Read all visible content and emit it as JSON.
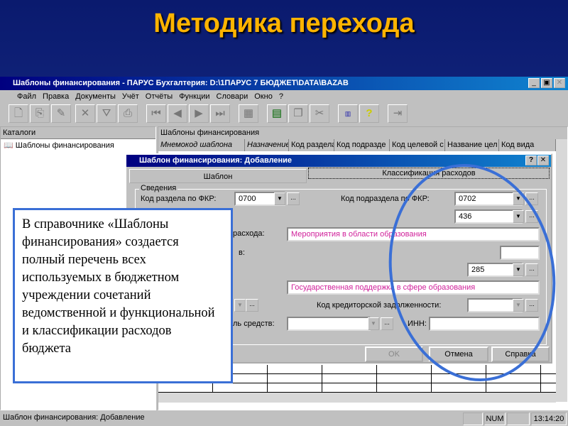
{
  "slide": {
    "title": "Методика перехода",
    "callout": "В справочнике «Шаблоны финансирования» создается полный перечень всех используемых в бюджетном учреждении сочетаний ведомственной и функциональной и классификации расходов бюджета",
    "accent": "#3a6fd6"
  },
  "window": {
    "title": "Шаблоны финансирования - ПАРУС Бухгалтерия: D:\\1ПАРУС 7 БЮДЖЕТ\\DATA\\BAZAB",
    "menu": [
      "Файл",
      "Правка",
      "Документы",
      "Учёт",
      "Отчёты",
      "Функции",
      "Словари",
      "Окно",
      "?"
    ],
    "left_pane": {
      "header": "Каталоги",
      "item": "Шаблоны финансирования"
    },
    "right_pane": {
      "header": "Шаблоны финансирования",
      "columns": [
        "Мнемокод шаблона",
        "Назначение",
        "Код раздела п",
        "Код подразде",
        "Код целевой с",
        "Название цел",
        "Код вида"
      ]
    },
    "status": {
      "text": "Шаблон финансирования: Добавление",
      "num": "NUM",
      "time": "13:14:20"
    }
  },
  "dialog": {
    "title": "Шаблон финансирования: Добавление",
    "tabs": [
      "Шаблон",
      "Классификация расходов"
    ],
    "group": "Сведения",
    "fkr_section_label": "Код раздела по ФКР:",
    "fkr_section": "0700",
    "fkr_subsection_label": "Код подраздела по ФКР:",
    "fkr_subsection": "0702",
    "target_code": "436",
    "expense_label": "расхода:",
    "expense_name": "Мероприятия в области образования",
    "label_v": "в:",
    "type_code": "285",
    "type_name": "Государственная поддержка в сфере образования",
    "creditor_label": "Код кредиторской задолженности:",
    "funds_label": "ль средств:",
    "inn_label": "ИНН:",
    "ok": "OK",
    "cancel": "Отмена",
    "help": "Справка"
  }
}
